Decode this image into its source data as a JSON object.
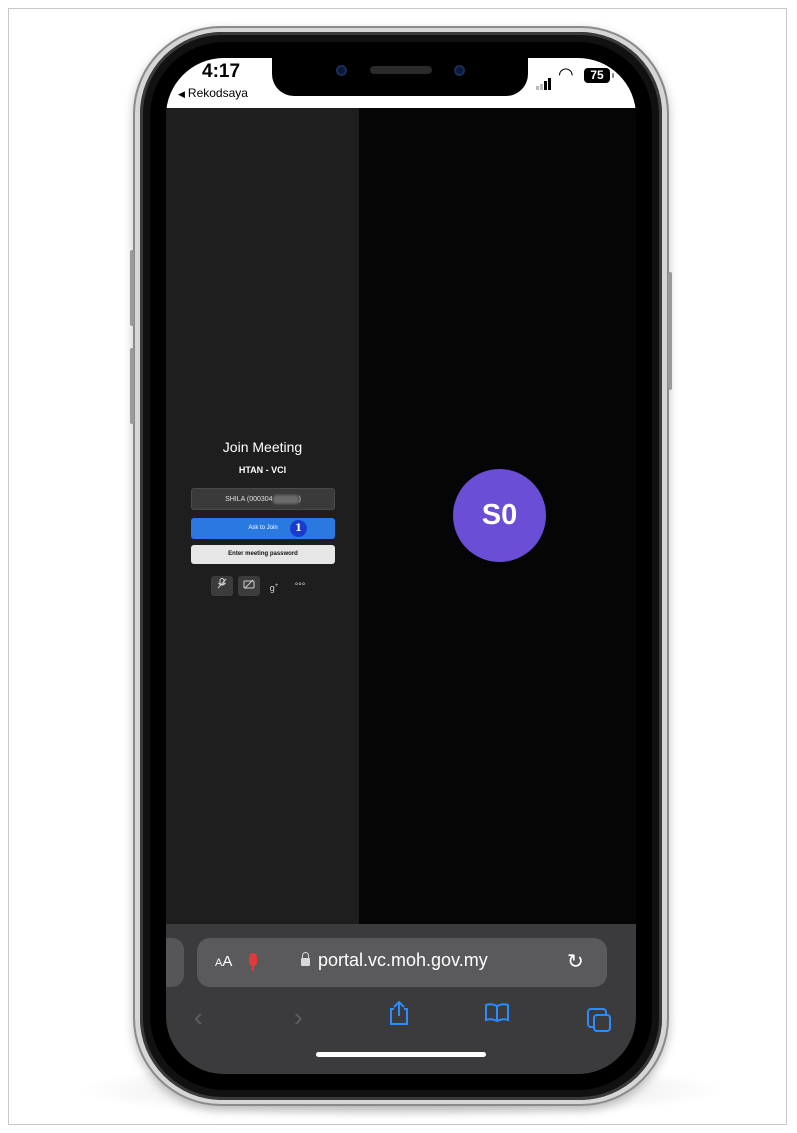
{
  "status_bar": {
    "time": "4:17",
    "back_app": "Rekodsaya",
    "battery": "75"
  },
  "meeting": {
    "title": "Join Meeting",
    "subtitle": "HTAN - VCI",
    "name_field_value": "SHILA (000304",
    "name_field_suffix": ")",
    "ask_to_join_label": "Ask to Join",
    "step_marker": "1",
    "password_button_label": "Enter meeting password",
    "controls": {
      "mic": "mic-muted-icon",
      "camera": "camera-off-icon",
      "invite": "add-person-icon",
      "more": "more-icon"
    },
    "avatar_initials": "S0",
    "avatar_color": "#6a4ed6",
    "accent_color": "#2a79e0"
  },
  "browser": {
    "text_size_label_small": "A",
    "text_size_label_large": "A",
    "url": "portal.vc.moh.gov.my"
  }
}
